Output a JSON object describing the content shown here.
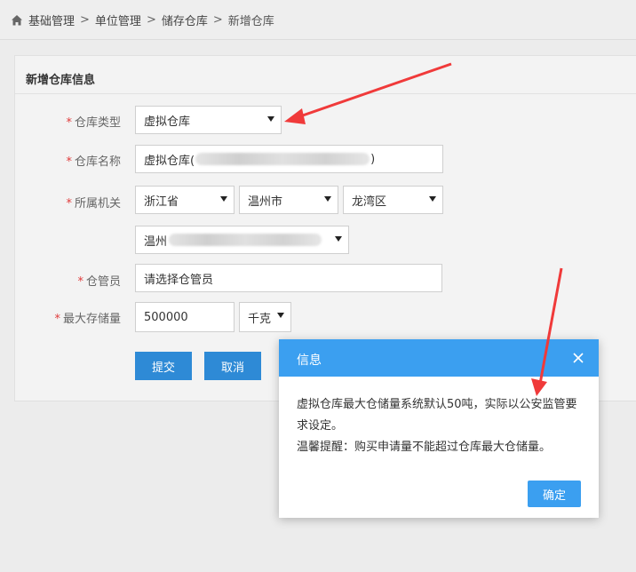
{
  "breadcrumb": {
    "items": [
      "基础管理",
      "单位管理",
      "储存仓库",
      "新增仓库"
    ],
    "separator": ">"
  },
  "panel": {
    "title": "新增仓库信息"
  },
  "form": {
    "required_mark": "*",
    "type": {
      "label": "仓库类型",
      "value": "虚拟仓库"
    },
    "name": {
      "label": "仓库名称",
      "value_prefix": "虚拟仓库(",
      "value_suffix": ")"
    },
    "org": {
      "label": "所属机关",
      "province": "浙江省",
      "city": "温州市",
      "district": "龙湾区",
      "unit_prefix": "温州"
    },
    "keeper": {
      "label": "仓管员",
      "value": "请选择仓管员"
    },
    "capacity": {
      "label": "最大存储量",
      "value": "500000",
      "unit": "千克"
    },
    "submit_label": "提交",
    "cancel_label": "取消"
  },
  "dialog": {
    "title": "信息",
    "line1": "虚拟仓库最大仓储量系统默认50吨，实际以公安监管要求设定。",
    "line2": "温馨提醒：购买申请量不能超过仓库最大仓储量。",
    "ok_label": "确定"
  },
  "colors": {
    "primary": "#2e8ad6",
    "dialog_header": "#3b9ff0",
    "required": "#e03b3b",
    "arrow": "#f03a3a"
  },
  "icons": {
    "home": "home-icon",
    "close": "close-icon",
    "caret": "caret-down-icon"
  }
}
